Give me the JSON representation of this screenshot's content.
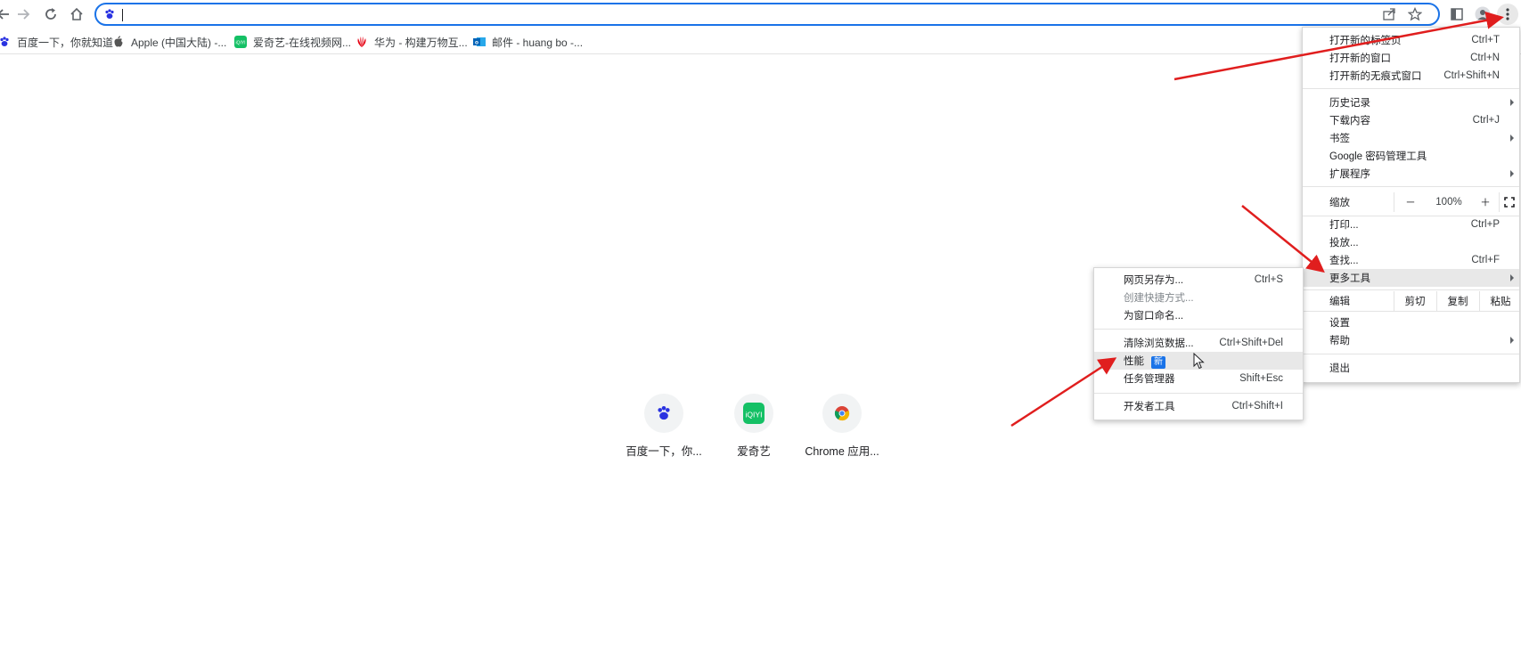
{
  "bookmarks": [
    {
      "label": "百度一下，你就知道",
      "icon": "baidu-paw-icon"
    },
    {
      "label": "Apple (中国大陆) -...",
      "icon": "apple-icon"
    },
    {
      "label": "爱奇艺-在线视频网...",
      "icon": "iqiyi-icon"
    },
    {
      "label": "华为 - 构建万物互...",
      "icon": "huawei-icon"
    },
    {
      "label": "邮件 - huang bo -...",
      "icon": "outlook-icon"
    }
  ],
  "shortcuts": [
    {
      "label": "百度一下，你...",
      "icon": "baidu-paw-icon"
    },
    {
      "label": "爱奇艺",
      "icon": "iqiyi-icon"
    },
    {
      "label": "Chrome 应用...",
      "icon": "chrome-icon"
    }
  ],
  "main_menu": {
    "new_tab": {
      "label": "打开新的标签页",
      "key": "Ctrl+T"
    },
    "new_window": {
      "label": "打开新的窗口",
      "key": "Ctrl+N"
    },
    "new_incognito": {
      "label": "打开新的无痕式窗口",
      "key": "Ctrl+Shift+N"
    },
    "history": {
      "label": "历史记录"
    },
    "downloads": {
      "label": "下载内容",
      "key": "Ctrl+J"
    },
    "bookmarks": {
      "label": "书签"
    },
    "password_manager": {
      "label": "Google 密码管理工具"
    },
    "extensions": {
      "label": "扩展程序"
    },
    "zoom": {
      "label": "缩放",
      "minus": "－",
      "value": "100%",
      "plus": "＋"
    },
    "print": {
      "label": "打印...",
      "key": "Ctrl+P"
    },
    "cast": {
      "label": "投放..."
    },
    "find": {
      "label": "查找...",
      "key": "Ctrl+F"
    },
    "more_tools": {
      "label": "更多工具"
    },
    "edit": {
      "label": "编辑",
      "cut": "剪切",
      "copy": "复制",
      "paste": "粘贴"
    },
    "settings": {
      "label": "设置"
    },
    "help": {
      "label": "帮助"
    },
    "exit": {
      "label": "退出"
    }
  },
  "sub_menu": {
    "save_page": {
      "label": "网页另存为...",
      "key": "Ctrl+S"
    },
    "create_shortcut": {
      "label": "创建快捷方式..."
    },
    "name_window": {
      "label": "为窗口命名..."
    },
    "clear_data": {
      "label": "清除浏览数据...",
      "key": "Ctrl+Shift+Del"
    },
    "performance": {
      "label": "性能",
      "badge": "新"
    },
    "task_manager": {
      "label": "任务管理器",
      "key": "Shift+Esc"
    },
    "dev_tools": {
      "label": "开发者工具",
      "key": "Ctrl+Shift+I"
    }
  },
  "colors": {
    "accent": "#1a73e8",
    "arrow": "#e01e1e",
    "highlight": "#e8e8e8"
  }
}
